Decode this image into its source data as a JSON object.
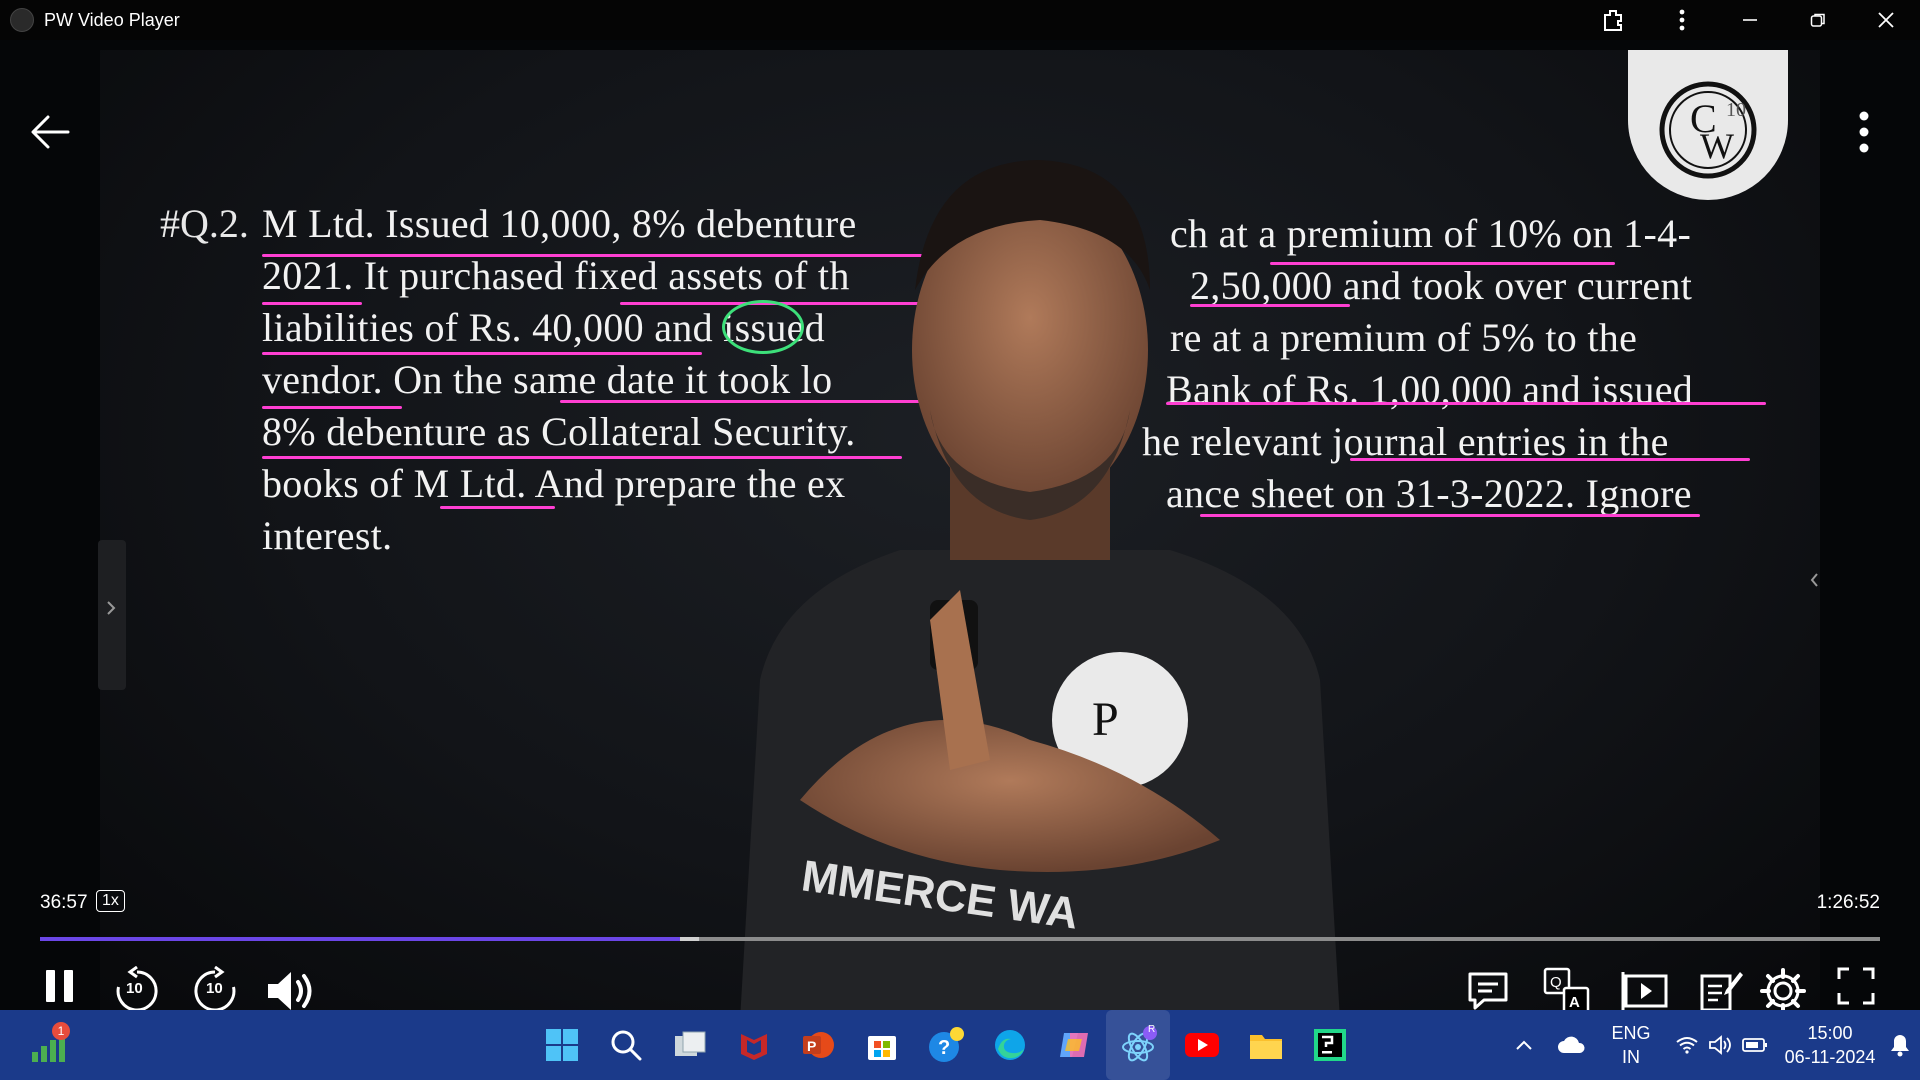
{
  "window": {
    "title": "PW Video Player"
  },
  "question": {
    "number": "#Q.2.",
    "lines": [
      "M Ltd. Issued 10,000, 8% debenture",
      "2021. It purchased fixed assets of th",
      "liabilities of Rs. 40,000 and issued",
      "vendor. On the same date it took lo",
      "8% debenture as Collateral Security.",
      "books of M Ltd. And prepare the ex",
      "interest."
    ],
    "right_lines": [
      "ch at a premium of 10% on 1-4-",
      "2,50,000 and took over current",
      "re at a premium of 5% to the",
      "Bank of Rs. 1,00,000 and issued",
      "he relevant journal entries in the",
      "ance sheet on 31-3-2022. Ignore"
    ]
  },
  "badge": {
    "letters": "CW",
    "superscript": "10"
  },
  "shirt_text": "MMERCE WA",
  "player": {
    "current_time": "36:57",
    "speed": "1x",
    "total_time": "1:26:52",
    "progress": 0.348,
    "buffered": 0.358,
    "rewind_label": "10",
    "forward_label": "10",
    "accent_color": "#6b46e6"
  },
  "taskbar": {
    "notification_count": "1",
    "language": "ENG",
    "region": "IN",
    "time": "15:00",
    "date": "06-11-2024",
    "copilot_badge": "R"
  },
  "icons": {
    "controls_left": [
      "pause-icon",
      "rewind-10-icon",
      "forward-10-icon",
      "volume-icon"
    ],
    "controls_right": [
      "comments-icon",
      "translate-icon",
      "playlist-icon",
      "notes-icon",
      "settings-icon",
      "fullscreen-icon"
    ]
  }
}
